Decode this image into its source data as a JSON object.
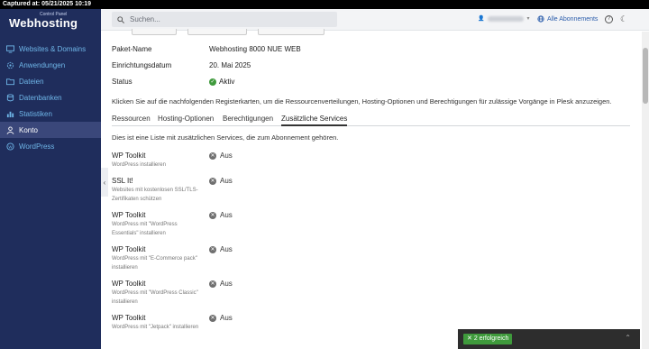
{
  "capture": "Captured at: 05/21/2025 10:19",
  "brand": {
    "small": "Control Panel",
    "name": "Webhosting"
  },
  "nav": [
    {
      "label": "Websites & Domains",
      "icon": "monitor-icon"
    },
    {
      "label": "Anwendungen",
      "icon": "gear-icon"
    },
    {
      "label": "Dateien",
      "icon": "folder-icon"
    },
    {
      "label": "Datenbanken",
      "icon": "database-icon"
    },
    {
      "label": "Statistiken",
      "icon": "chart-icon"
    },
    {
      "label": "Konto",
      "icon": "user-icon",
      "active": true
    },
    {
      "label": "WordPress",
      "icon": "wordpress-icon"
    }
  ],
  "search": {
    "placeholder": "Suchen..."
  },
  "header": {
    "subscriptions": "Alle Abonnements",
    "help": "?",
    "theme": "☾"
  },
  "info": {
    "package_label": "Paket-Name",
    "package_value": "Webhosting 8000 NUE WEB",
    "date_label": "Einrichtungsdatum",
    "date_value": "20. Mai 2025",
    "status_label": "Status",
    "status_value": "Aktiv"
  },
  "note": "Klicken Sie auf die nachfolgenden Registerkarten, um die Ressourcenverteilungen, Hosting-Optionen und Berechtigungen für zulässige Vorgänge in Plesk anzuzeigen.",
  "tabs": [
    "Ressourcen",
    "Hosting-Optionen",
    "Berechtigungen",
    "Zusätzliche Services"
  ],
  "intro": "Dies ist eine Liste mit zusätzlichen Services, die zum Abonnement gehören.",
  "services": [
    {
      "title": "WP Toolkit",
      "desc": "WordPress installieren",
      "status": "Aus"
    },
    {
      "title": "SSL It!",
      "desc": "Websites mit kostenlosen SSL/TLS-Zertifikaten schützen",
      "status": "Aus"
    },
    {
      "title": "WP Toolkit",
      "desc": "WordPress mit \"WordPress Essentials\" installieren",
      "status": "Aus"
    },
    {
      "title": "WP Toolkit",
      "desc": "WordPress mit \"E-Commerce pack\" installieren",
      "status": "Aus"
    },
    {
      "title": "WP Toolkit",
      "desc": "WordPress mit \"WordPress Classic\" installieren",
      "status": "Aus"
    },
    {
      "title": "WP Toolkit",
      "desc": "WordPress mit \"Jetpack\" installieren",
      "status": "Aus"
    }
  ],
  "toast": {
    "label": "2 erfolgreich"
  },
  "colors": {
    "sidebar": "#1f2d5c",
    "accent": "#2b5dab",
    "success": "#3f9a3c"
  }
}
